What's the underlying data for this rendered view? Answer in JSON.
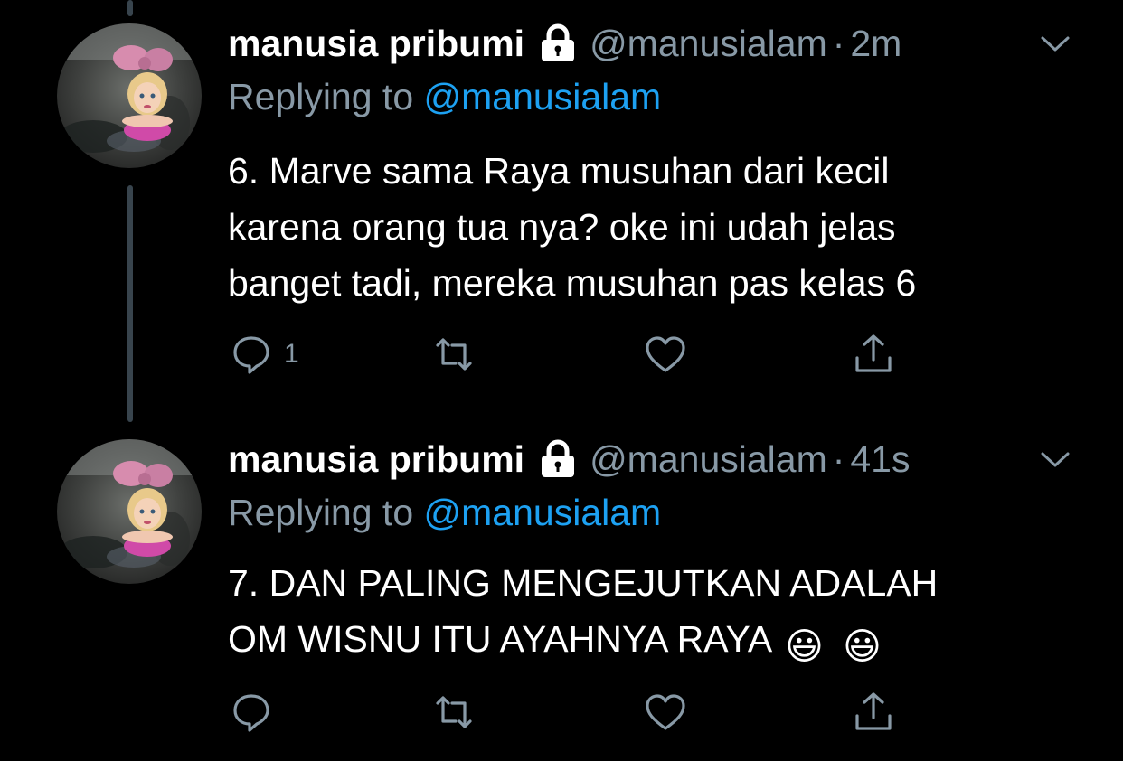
{
  "colors": {
    "background": "#000000",
    "primary_text": "#ffffff",
    "secondary_text": "#8899a6",
    "link": "#1da1f2",
    "thread_line": "#38444d"
  },
  "tweets": [
    {
      "display_name": "manusia pribumi",
      "protected_icon": "lock-icon",
      "handle": "@manusialam",
      "separator": "·",
      "time": "2m",
      "reply_prefix": "Replying to",
      "reply_target": "@manusialam",
      "text": "6. Marve sama Raya musuhan dari kecil\nkarena orang tua nya? oke ini udah jelas\nbanget tadi, mereka musuhan pas kelas 6",
      "emojis": [],
      "actions": {
        "reply_icon": "reply-icon",
        "reply_count": "1",
        "retweet_icon": "retweet-icon",
        "like_icon": "heart-icon",
        "share_icon": "share-icon"
      }
    },
    {
      "display_name": "manusia pribumi",
      "protected_icon": "lock-icon",
      "handle": "@manusialam",
      "separator": "·",
      "time": "41s",
      "reply_prefix": "Replying to",
      "reply_target": "@manusialam",
      "text": "7. DAN PALING MENGEJUTKAN ADALAH\nOM WISNU ITU AYAHNYA RAYA",
      "emojis": [
        "😃",
        "😃"
      ],
      "actions": {
        "reply_icon": "reply-icon",
        "reply_count": "",
        "retweet_icon": "retweet-icon",
        "like_icon": "heart-icon",
        "share_icon": "share-icon"
      }
    }
  ]
}
